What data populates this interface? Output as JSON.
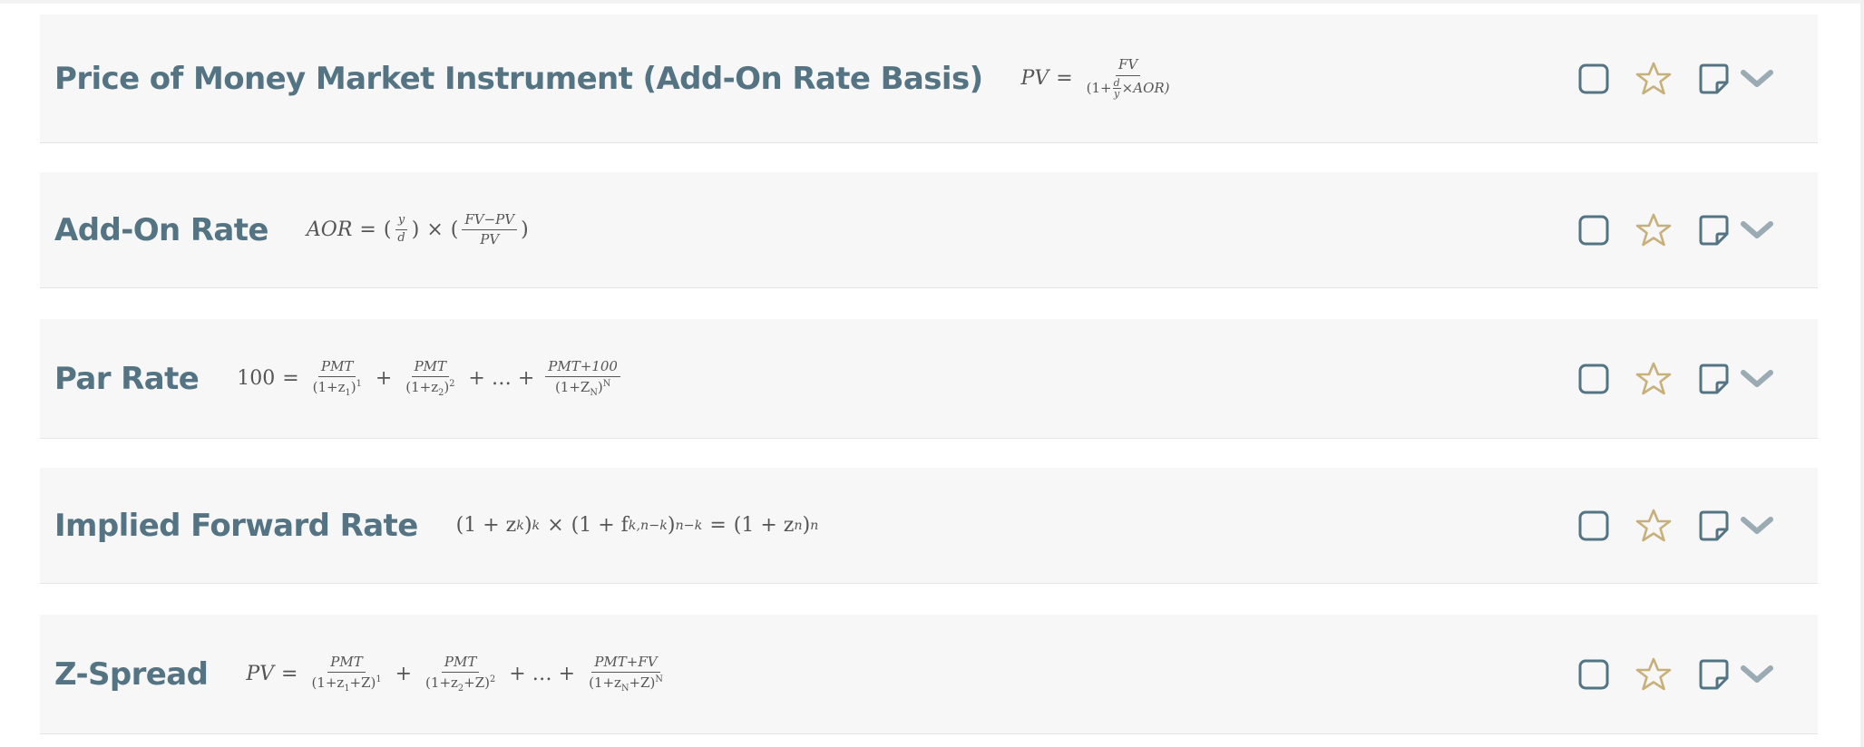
{
  "colors": {
    "title": "#547483",
    "icon": "#547483",
    "star": "#c8b07a",
    "chevron": "#9aabb3",
    "card": "#f7f7f7"
  },
  "icons": {
    "checkbox": "square-outline",
    "favorite": "star-outline",
    "note": "sticky-note-outline",
    "expand": "chevron-down"
  },
  "items": [
    {
      "title": "Price of Money Market Instrument (Add-On Rate Basis)",
      "formula": {
        "lhs": "PV",
        "num": "FV",
        "den_pre": "(1+",
        "den_frac_num": "d",
        "den_frac_den": "y",
        "den_post": "×AOR)"
      }
    },
    {
      "title": "Add-On Rate",
      "formula": {
        "lhs": "AOR",
        "f1_num": "y",
        "f1_den": "d",
        "f2_num": "FV−PV",
        "f2_den": "PV"
      }
    },
    {
      "title": "Par Rate",
      "formula": {
        "lhs": "100",
        "t1_num": "PMT",
        "t1_den": "(1+z",
        "t1_sub": "1",
        "t1_exp": "1",
        "t2_num": "PMT",
        "t2_den": "(1+z",
        "t2_sub": "2",
        "t2_exp": "2",
        "dots": "+ … +",
        "t3_num": "PMT+100",
        "t3_den": "(1+Z",
        "t3_sub": "N",
        "t3_exp": "N"
      }
    },
    {
      "title": "Implied Forward Rate",
      "formula": {
        "a": "(1 + z",
        "a_sub": "k",
        "a_exp": "k",
        "b": "(1 + f",
        "b_sub": "k,n−k",
        "b_exp": "n−k",
        "c": "(1 + z",
        "c_sub": "n",
        "c_exp": "n"
      }
    },
    {
      "title": "Z-Spread",
      "formula": {
        "lhs": "PV",
        "t1_num": "PMT",
        "t1_den": "(1+z",
        "t1_sub": "1",
        "t1_post": "+Z)",
        "t1_exp": "1",
        "t2_num": "PMT",
        "t2_den": "(1+z",
        "t2_sub": "2",
        "t2_post": "+Z)",
        "t2_exp": "2",
        "dots": "+ … +",
        "t3_num": "PMT+FV",
        "t3_den": "(1+z",
        "t3_sub": "N",
        "t3_post": "+Z)",
        "t3_exp": "N"
      }
    }
  ]
}
